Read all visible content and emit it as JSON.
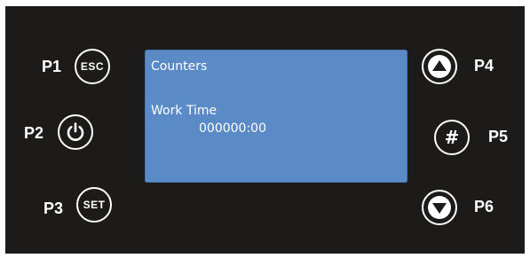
{
  "display": {
    "title": "Counters",
    "label": "Work Time",
    "value": "000000:00"
  },
  "buttons": {
    "p1": {
      "label": "P1",
      "text": "ESC"
    },
    "p2": {
      "label": "P2",
      "icon": "power-icon"
    },
    "p3": {
      "label": "P3",
      "text": "SET"
    },
    "p4": {
      "label": "P4",
      "icon": "up-arrow-icon"
    },
    "p5": {
      "label": "P5",
      "text": "#"
    },
    "p6": {
      "label": "P6",
      "icon": "down-arrow-icon"
    }
  },
  "colors": {
    "panel": "#1d1b1a",
    "lcd": "#5b8bc6",
    "foreground": "#ffffff"
  }
}
